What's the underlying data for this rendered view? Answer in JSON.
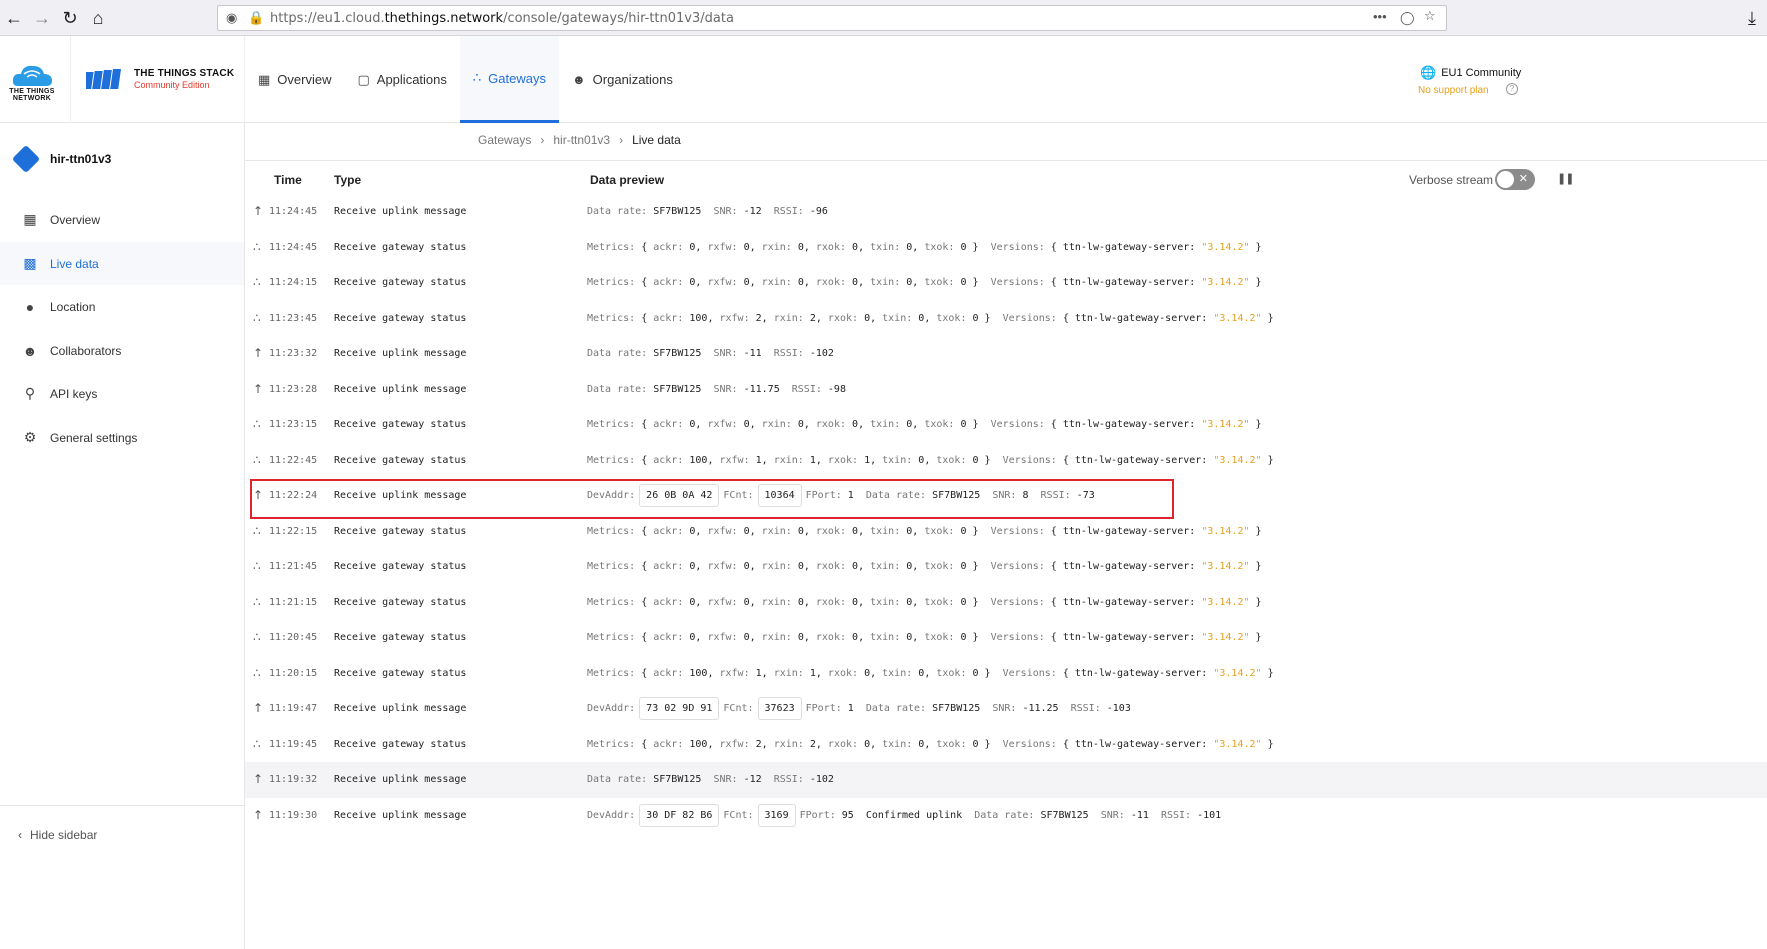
{
  "browser": {
    "url_prefix": "https://eu1.cloud.",
    "url_domain": "thethings.network",
    "url_path": "/console/gateways/hir-ttn01v3/data",
    "more": "•••"
  },
  "header": {
    "ttn_logo_text": "THE THINGS NETWORK",
    "stack_title": "THE THINGS STACK",
    "stack_subtitle": "Community Edition",
    "nav": [
      {
        "label": "Overview",
        "icon": "grid-icon"
      },
      {
        "label": "Applications",
        "icon": "square-icon"
      },
      {
        "label": "Gateways",
        "icon": "gateway-icon"
      },
      {
        "label": "Organizations",
        "icon": "people-icon"
      }
    ],
    "region": "EU1 Community",
    "support": "No support plan"
  },
  "sidebar": {
    "gateway_name": "hir-ttn01v3",
    "items": [
      {
        "label": "Overview",
        "icon": "grid-icon"
      },
      {
        "label": "Live data",
        "icon": "bar-chart-icon"
      },
      {
        "label": "Location",
        "icon": "pin-icon"
      },
      {
        "label": "Collaborators",
        "icon": "people-icon"
      },
      {
        "label": "API keys",
        "icon": "key-icon"
      },
      {
        "label": "General settings",
        "icon": "gear-icon"
      }
    ],
    "hide_label": "Hide sidebar"
  },
  "breadcrumb": [
    "Gateways",
    "hir-ttn01v3",
    "Live data"
  ],
  "table": {
    "headers": {
      "time": "Time",
      "type": "Type",
      "preview": "Data preview"
    },
    "verbose_label": "Verbose stream",
    "rows": [
      {
        "dir": "up",
        "time": "11:24:45",
        "type": "Receive uplink message",
        "kind": "uplink",
        "data_rate": "SF7BW125",
        "snr": "-12",
        "rssi": "-96"
      },
      {
        "dir": "status",
        "time": "11:24:45",
        "type": "Receive gateway status",
        "kind": "status",
        "ackr": "0",
        "rxfw": "0",
        "rxin": "0",
        "rxok": "0",
        "txin": "0",
        "txok": "0",
        "version": "3.14.2"
      },
      {
        "dir": "status",
        "time": "11:24:15",
        "type": "Receive gateway status",
        "kind": "status",
        "ackr": "0",
        "rxfw": "0",
        "rxin": "0",
        "rxok": "0",
        "txin": "0",
        "txok": "0",
        "version": "3.14.2"
      },
      {
        "dir": "status",
        "time": "11:23:45",
        "type": "Receive gateway status",
        "kind": "status",
        "ackr": "100",
        "rxfw": "2",
        "rxin": "2",
        "rxok": "0",
        "txin": "0",
        "txok": "0",
        "version": "3.14.2"
      },
      {
        "dir": "up",
        "time": "11:23:32",
        "type": "Receive uplink message",
        "kind": "uplink",
        "data_rate": "SF7BW125",
        "snr": "-11",
        "rssi": "-102"
      },
      {
        "dir": "up",
        "time": "11:23:28",
        "type": "Receive uplink message",
        "kind": "uplink",
        "data_rate": "SF7BW125",
        "snr": "-11.75",
        "rssi": "-98"
      },
      {
        "dir": "status",
        "time": "11:23:15",
        "type": "Receive gateway status",
        "kind": "status",
        "ackr": "0",
        "rxfw": "0",
        "rxin": "0",
        "rxok": "0",
        "txin": "0",
        "txok": "0",
        "version": "3.14.2"
      },
      {
        "dir": "status",
        "time": "11:22:45",
        "type": "Receive gateway status",
        "kind": "status",
        "ackr": "100",
        "rxfw": "1",
        "rxin": "1",
        "rxok": "1",
        "txin": "0",
        "txok": "0",
        "version": "3.14.2"
      },
      {
        "dir": "up",
        "time": "11:22:24",
        "type": "Receive uplink message",
        "kind": "devuplink",
        "devaddr": "26 0B 0A 42",
        "fcnt": "10364",
        "fport": "1",
        "confirmed": "",
        "data_rate": "SF7BW125",
        "snr": "8",
        "rssi": "-73"
      },
      {
        "dir": "status",
        "time": "11:22:15",
        "type": "Receive gateway status",
        "kind": "status",
        "ackr": "0",
        "rxfw": "0",
        "rxin": "0",
        "rxok": "0",
        "txin": "0",
        "txok": "0",
        "version": "3.14.2"
      },
      {
        "dir": "status",
        "time": "11:21:45",
        "type": "Receive gateway status",
        "kind": "status",
        "ackr": "0",
        "rxfw": "0",
        "rxin": "0",
        "rxok": "0",
        "txin": "0",
        "txok": "0",
        "version": "3.14.2"
      },
      {
        "dir": "status",
        "time": "11:21:15",
        "type": "Receive gateway status",
        "kind": "status",
        "ackr": "0",
        "rxfw": "0",
        "rxin": "0",
        "rxok": "0",
        "txin": "0",
        "txok": "0",
        "version": "3.14.2"
      },
      {
        "dir": "status",
        "time": "11:20:45",
        "type": "Receive gateway status",
        "kind": "status",
        "ackr": "0",
        "rxfw": "0",
        "rxin": "0",
        "rxok": "0",
        "txin": "0",
        "txok": "0",
        "version": "3.14.2"
      },
      {
        "dir": "status",
        "time": "11:20:15",
        "type": "Receive gateway status",
        "kind": "status",
        "ackr": "100",
        "rxfw": "1",
        "rxin": "1",
        "rxok": "0",
        "txin": "0",
        "txok": "0",
        "version": "3.14.2"
      },
      {
        "dir": "up",
        "time": "11:19:47",
        "type": "Receive uplink message",
        "kind": "devuplink",
        "devaddr": "73 02 9D 91",
        "fcnt": "37623",
        "fport": "1",
        "confirmed": "",
        "data_rate": "SF7BW125",
        "snr": "-11.25",
        "rssi": "-103"
      },
      {
        "dir": "status",
        "time": "11:19:45",
        "type": "Receive gateway status",
        "kind": "status",
        "ackr": "100",
        "rxfw": "2",
        "rxin": "2",
        "rxok": "0",
        "txin": "0",
        "txok": "0",
        "version": "3.14.2"
      },
      {
        "dir": "up",
        "time": "11:19:32",
        "type": "Receive uplink message",
        "kind": "uplink",
        "data_rate": "SF7BW125",
        "snr": "-12",
        "rssi": "-102",
        "highlighted": true
      },
      {
        "dir": "up",
        "time": "11:19:30",
        "type": "Receive uplink message",
        "kind": "devuplink",
        "devaddr": "30 DF 82 B6",
        "fcnt": "3169",
        "fport": "95",
        "confirmed": "Confirmed uplink",
        "data_rate": "SF7BW125",
        "snr": "-11",
        "rssi": "-101"
      }
    ]
  },
  "colors": {
    "accent": "#1e6fd9",
    "string": "#e6a020",
    "highlight_box": "#e0242e",
    "brand_red": "#e2392a"
  }
}
